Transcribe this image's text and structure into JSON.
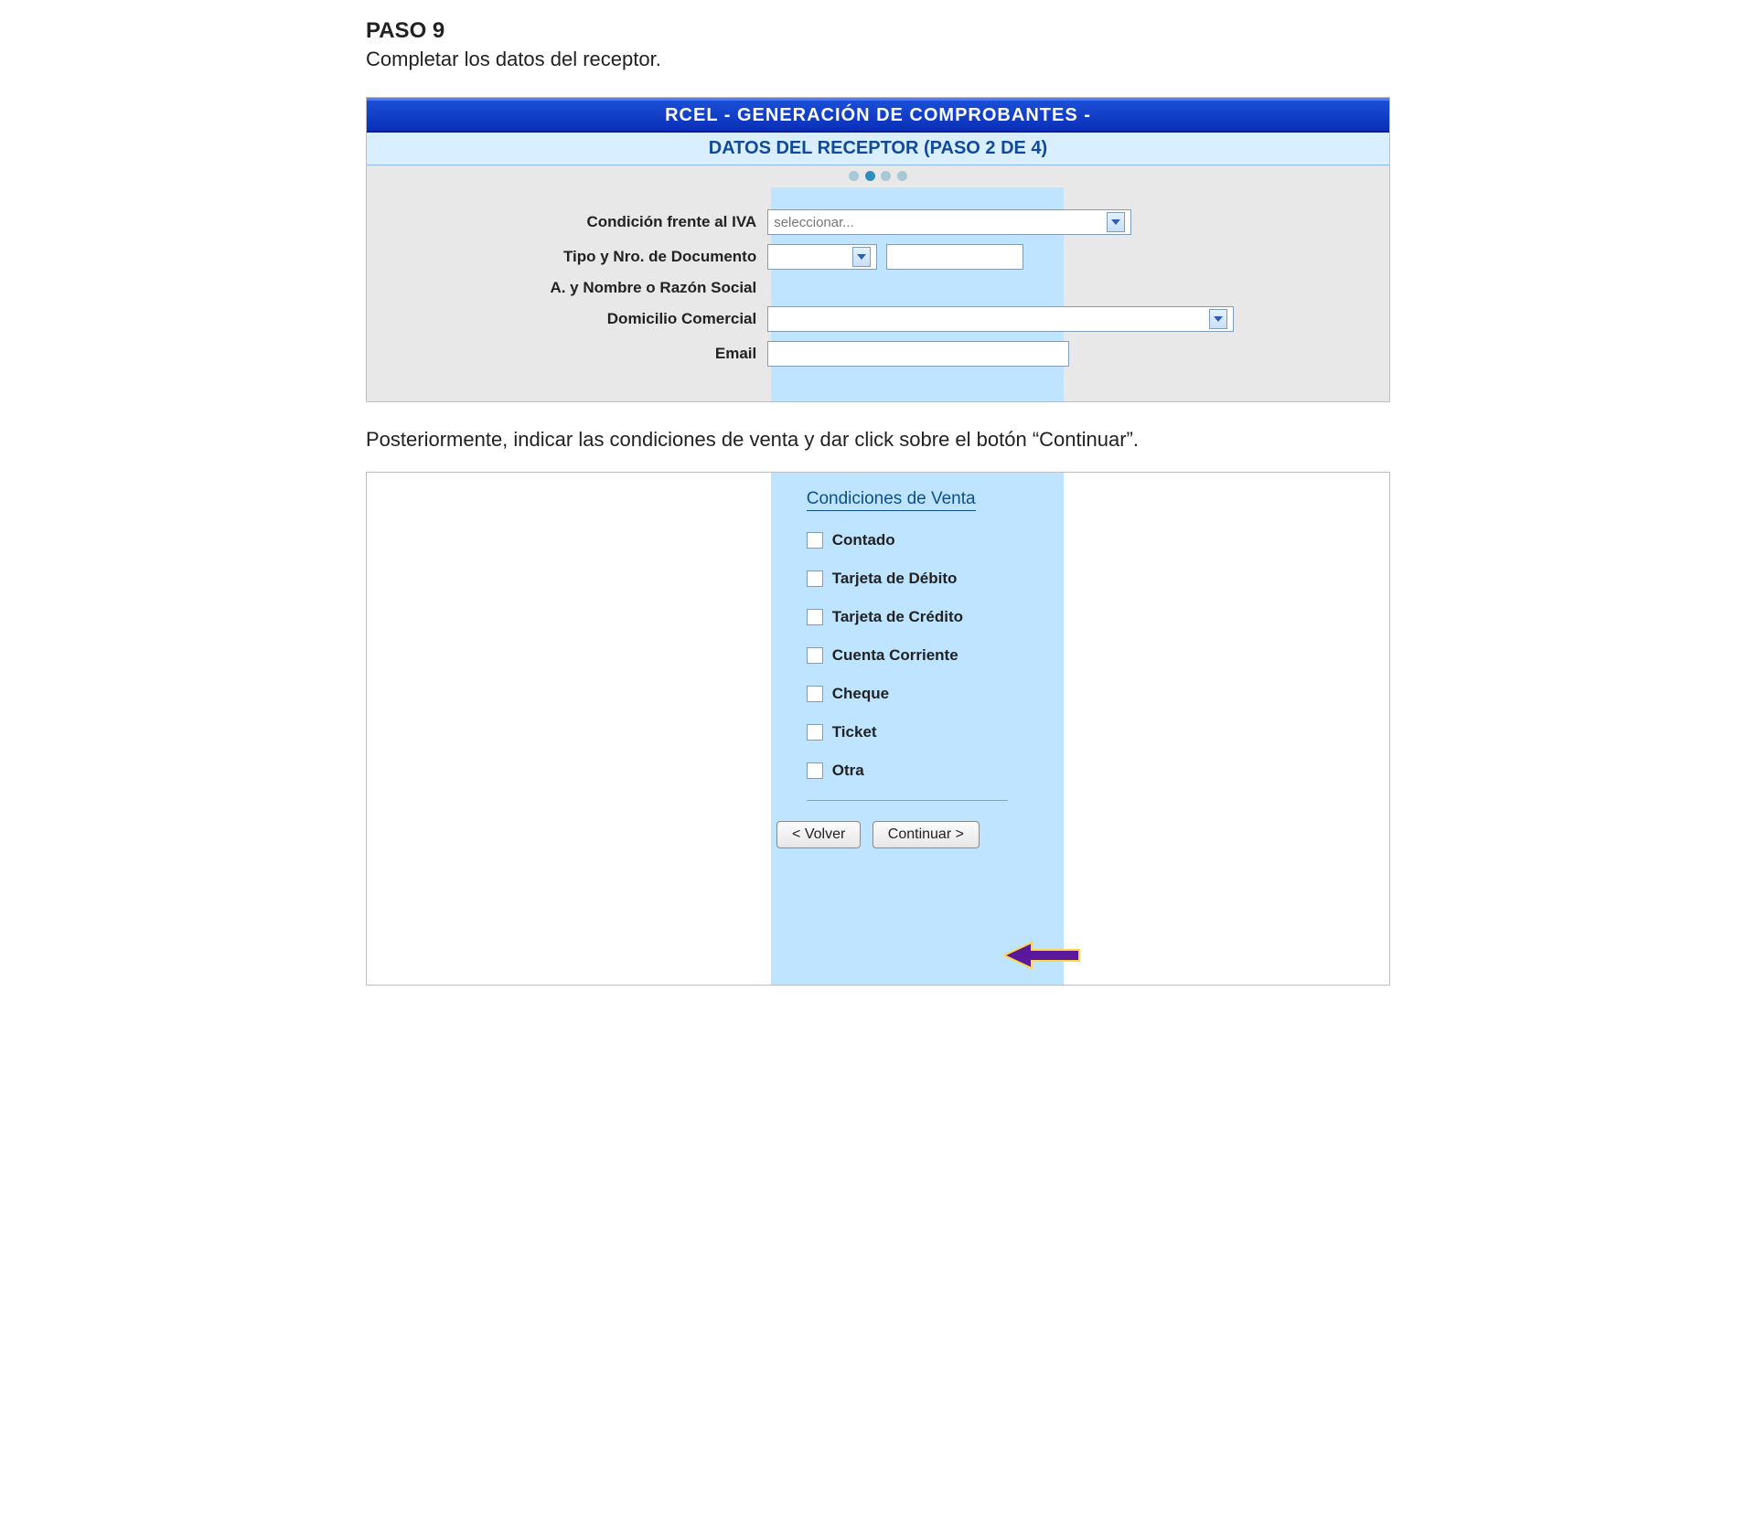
{
  "step": {
    "title": "PASO 9",
    "description": "Completar los datos del receptor."
  },
  "panel": {
    "header": "RCEL - GENERACIÓN DE COMPROBANTES -",
    "subheader": "DATOS DEL RECEPTOR (PASO 2 DE 4)",
    "stepper_total": 4,
    "stepper_active": 2,
    "fields": {
      "iva_label": "Condición frente al IVA",
      "iva_placeholder": "seleccionar...",
      "doc_label": "Tipo y Nro. de Documento",
      "razon_label": "A. y Nombre o Razón Social",
      "domicilio_label": "Domicilio Comercial",
      "email_label": "Email"
    }
  },
  "followup_text": "Posteriormente, indicar las condiciones de venta y dar click sobre el botón “Continuar”.",
  "venta": {
    "title": "Condiciones de Venta",
    "options": [
      "Contado",
      "Tarjeta de Débito",
      "Tarjeta de Crédito",
      "Cuenta Corriente",
      "Cheque",
      "Ticket",
      "Otra"
    ]
  },
  "buttons": {
    "back": "< Volver",
    "next": "Continuar >"
  },
  "colors": {
    "header_blue": "#0a2fb8",
    "sub_blue_bg": "#d9eeff",
    "band_blue": "#bfe4ff",
    "arrow_purple": "#5a189a",
    "arrow_outline": "#ffd54a"
  }
}
